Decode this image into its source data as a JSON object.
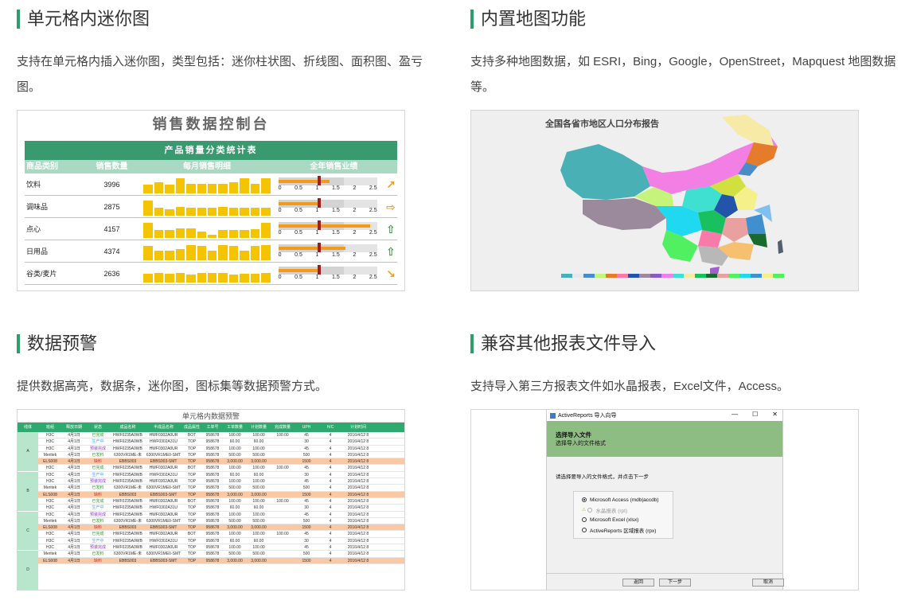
{
  "sections": [
    {
      "title": "单元格内迷你图",
      "desc": "支持在单元格内插入迷你图，类型包括：迷你柱状图、折线图、面积图、盈亏图。"
    },
    {
      "title": "内置地图功能",
      "desc": "支持多种地图数据，如 ESRI，Bing，Google，OpenStreet，Mapquest 地图数据等。"
    },
    {
      "title": "数据预警",
      "desc": "提供数据高亮，数据条，迷你图，图标集等数据预警方式。"
    },
    {
      "title": "兼容其他报表文件导入",
      "desc": "支持导入第三方报表文件如水晶报表，Excel文件，Access。"
    }
  ],
  "dashboard": {
    "title": "销售数据控制台",
    "table_title": "产品销量分类统计表",
    "columns": [
      "商品类别",
      "销售数量",
      "每月销售明细",
      "全年销售业绩"
    ],
    "ticks": [
      "0",
      "0.5",
      "1",
      "1.5",
      "2",
      "2.5"
    ],
    "rows": [
      {
        "name": "饮料",
        "qty": "3996",
        "bars": [
          0.55,
          0.7,
          0.55,
          0.95,
          0.6,
          0.6,
          0.6,
          0.6,
          0.7,
          0.95,
          0.6,
          0.95
        ],
        "perf": 0.52,
        "target": 0.4,
        "arrow": "↗",
        "arrow_color": "#f0a020"
      },
      {
        "name": "调味品",
        "qty": "2875",
        "bars": [
          0.95,
          0.5,
          0.4,
          0.55,
          0.5,
          0.5,
          0.5,
          0.55,
          0.5,
          0.5,
          0.5,
          0.5
        ],
        "perf": 0.4,
        "target": 0.4,
        "arrow": "⇨",
        "arrow_color": "#f0a020"
      },
      {
        "name": "点心",
        "qty": "4157",
        "bars": [
          0.95,
          0.5,
          0.5,
          0.6,
          0.6,
          0.4,
          0.2,
          0.5,
          0.5,
          0.5,
          0.55,
          0.95
        ],
        "perf": 0.93,
        "target": 0.4,
        "arrow": "⇧",
        "arrow_color": "#3a9a3a"
      },
      {
        "name": "日用品",
        "qty": "4374",
        "bars": [
          0.9,
          0.6,
          0.6,
          0.7,
          0.95,
          0.9,
          0.6,
          0.95,
          0.9,
          0.6,
          0.9,
          0.95
        ],
        "perf": 0.68,
        "target": 0.4,
        "arrow": "⇧",
        "arrow_color": "#3a9a3a"
      },
      {
        "name": "谷类/麦片",
        "qty": "2636",
        "bars": [
          0.55,
          0.6,
          0.55,
          0.6,
          0.5,
          0.6,
          0.6,
          0.6,
          0.5,
          0.55,
          0.55,
          0.6
        ],
        "perf": 0.4,
        "target": 0.4,
        "arrow": "↘",
        "arrow_color": "#f0a020"
      }
    ]
  },
  "map": {
    "title": "全国各省市地区人口分布报告"
  },
  "warn_table": {
    "title": "单元格内数据预警",
    "headers": [
      "线体",
      "班组",
      "释放日期",
      "状态",
      "成品名称",
      "半成品名称",
      "成品属性",
      "工单号",
      "工单数量",
      "计划数量",
      "完成数量",
      "UPH",
      "H/C",
      "计划时间"
    ],
    "groups": [
      "A",
      "B",
      "C",
      "D"
    ],
    "rows": [
      [
        "H3C",
        "4月1日",
        "已完成",
        "HWF0235A0WB",
        "HWF0302A0UR",
        "BOT",
        "958678",
        "100.00",
        "100.00",
        "100.00",
        "45",
        "4",
        "2016/4/12 8"
      ],
      [
        "H3C",
        "4月1日",
        "生产中",
        "HWF0235A0WB",
        "HWF0302A31U",
        "TOP",
        "958678",
        "60.00",
        "60.00",
        "",
        "30",
        "4",
        "2016/4/12 8"
      ],
      [
        "H3C",
        "4月1日",
        "预装完成",
        "HWF0235A0WB",
        "HWF0302A0UR",
        "TOP",
        "958678",
        "100.00",
        "100.00",
        "",
        "45",
        "4",
        "2016/4/12 8"
      ],
      [
        "Meritek",
        "4月1日",
        "已发料",
        "6300VR1ME-未",
        "6300VR1ME0-SMT",
        "TOP",
        "958678",
        "500.00",
        "500.00",
        "",
        "500",
        "4",
        "2016/4/12 8"
      ],
      [
        "ELS008",
        "4月1日",
        "缺料",
        "EBBS003",
        "EBBS003-SMT",
        "TOP",
        "958678",
        "3,000.00",
        "3,000.00",
        "",
        "1500",
        "4",
        "2016/4/12 8"
      ]
    ]
  },
  "dialog": {
    "title": "ActiveReports 导入向导",
    "heading": "选择导入文件",
    "subheading": "选择导入的文件格式",
    "prompt": "请选择要导入的文件格式，并点击下一步",
    "options": [
      "Microsoft Access (mdb|accdb)",
      "水晶报表 (rpt)",
      "Microsoft Excel (xlsx)",
      "ActiveReports 区域报表 (rpx)"
    ],
    "back": "返回",
    "next": "下一步",
    "cancel": "取消"
  }
}
